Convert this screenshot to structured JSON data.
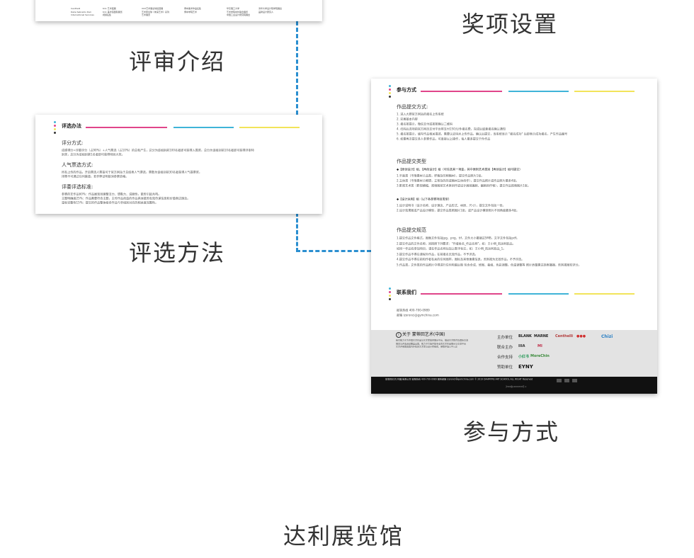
{
  "labels": {
    "review_intro": "评审介绍",
    "award_settings": "奖项设置",
    "selection_method": "评选方法",
    "participation": "参与方式",
    "gallery": "达利展览馆"
  },
  "colors": {
    "magenta": "#e0458a",
    "cyan": "#3fb4d8",
    "yellow": "#f2e45a",
    "dash_blue": "#2b8fd0",
    "footer_gray": "#e3e3e3",
    "footer_dark": "#111111"
  },
  "top_card": {
    "columns": [
      [
        "Centhelli",
        "Dalie Sabradio Dali",
        "International Services"
      ],
      [
        "K11 艺术夜展",
        "K11 美术馆国际展览",
        "视频征集"
      ],
      [
        "XXX艺术展全球巡回展",
        "艺术家全球《未来艺术》系列",
        "艺术展览"
      ],
      [
        "博中美术作品征集",
        "博中学院艺术"
      ],
      [
        "华东理工大学",
        "艺术学院中外联合展览",
        "中国工业设计研究院展出"
      ],
      [
        "清华大学设计院学院展出",
        "品牌设计研究人"
      ]
    ]
  },
  "selection_card": {
    "title": "评选办法",
    "scoring_heading": "评分方式:",
    "scoring_lines": [
      "成绩得分=评委评分（占90%）+人气票选（占10%）的总和产生，总分为该组别前100名者即可获得入围奖，总分为该组别前10名者即可获得评审特",
      "别奖，总分为该组别第1名者即可获得特别大奖。"
    ],
    "popular_heading": "人气票选方式:",
    "popular_lines": [
      "所有上传的作品，开启票选人票投可于官方网站于总结表人气票选，票数为该组别前30名者获得人气提票奖，",
      "排票不可通过任何渠道，若作弊证明取消参赛资格。"
    ],
    "criteria_heading": "评委评选标准:",
    "criteria_lines": [
      "参赛的艺作品60%：作品展现创意整洁力、想象力、说服性，能否引起共鸣。",
      "主题明确度25%：作品需要符合主题，主传作品创造的作品具体能否有效传递信息和价值表达理念。",
      "温标完整性15%：提交的作品整体组合作品与非组别对应的相关度完整性。"
    ]
  },
  "participation_card": {
    "title": "参与方式",
    "submit_heading": "作品提交方式:",
    "submit_lines": [
      "1. 进入大赛官方网站的报名上传系统",
      "2. 完善基本内容",
      "3. 报名按提示，微信支付或按按确认二维码",
      "4. 扫码后选项前官方网页支付平台将支付150元/件报名费，完成后留意报名确认通知",
      "5. 报名按提示，填写作品相关描述，需要认证码并上传作品，确认后提交，当系统显示 \"报名成功\" 后即表示成功报名，产生作品编号",
      "6. 如需再次提交多人参赛作品，可直接以上操作，每人最多提交于件作品"
    ],
    "type_heading": "作品提交类型",
    "type_a_title": "◆【原创设计】组、【再创设计】组（可任选其一项变，其中原则艺术类别【再创设计】组可提交）",
    "type_a_lines": [
      "1.平面类（不限素材兰品类，样稿及印刷稿材），提交作品照片1张。",
      "2.立体类（不限素材兰概想，立案及的的或稿材立体创作），提交作品照片或作品照片最多4张。",
      "3.影视艺术类（影视横幅、视频图前艺术原创作或设计展前编剧、编剧创作物），提交作品视频图片1张。"
    ],
    "type_b_title": "◆【设计运用】组（以下各参赛项目类型）",
    "type_b_lines": [
      "1.设计说明书（设计名称、设计理念、产品形式、材质、尺寸），提交文件包括一份。",
      "2.设计效果图或产品设计模型，提交作品类照图片1张，或产品设计模型照片不同角度最多4张。"
    ],
    "spec_heading": "作品提交规范",
    "spec_lines": [
      "1.提交作品文件格式，图像文件包括jpg、png、tif，文件大小最端达5MB，文字文件包括pdf。",
      "2.提交作品的文件名称，须按照下列要求：\"作者姓名_作品名称\"，如：王小明_凯运利取品。",
      "  如同一作品有参加项目，请在作品名称后加上数字标注，如：王小明_凯运利取品_1。",
      "3.提交作品不得在课程外作品，在前报名无效作品，不予评选。",
      "4.提交作品不得在前和作者有关的任何图样，图标及其他像素信息，否则视为无效作品，不予评选。",
      "5.作品类，文件类的作品照片中得进行任何电脑后制 包含合成、修图、裁组、色彩调整，色温调整等 照片质量需达到表播端，否则视图较评分。"
    ],
    "contact_title": "联系我们",
    "contact_phone": "报答热线 400-700-0989",
    "contact_email": "邮箱 izoronci@gymchina.com",
    "footer": {
      "about_title": "关于 蒙蒂回艺术(中国)",
      "about_lines": [
        "我们致力于为中国艺术作品与艺术家提供展示平台，推动艺术教育及国际交流",
        "展览与评选活动覆盖全国，致力于打造开放专业的艺术作品展示与交流平台",
        "艺术评审团由国内外知名艺术家与设计师组成，保障评选公平公正"
      ],
      "organizer_label": "主办单位",
      "co_organizer_label": "联合主办",
      "partner_label": "合作支持",
      "sponsor_label": "赞助单位",
      "organizer_logos": [
        "BLANK",
        "MARNE",
        "Centhelli",
        "●●●",
        "Chizi"
      ],
      "co_organizer_logos": [
        "IIIA",
        "MI"
      ],
      "partner_logos": [
        "小红书",
        "MoreChin"
      ],
      "sponsor_logos": [
        "EYNY"
      ]
    },
    "bottom_bar": "蒙蒂回艺术(中国)有限公司 客服热线 400-700-0989 服务邮箱 izoronci@gymchina.com © 2019 DAHMYRE ART SCHOOL ALL RIGHT Reserved",
    "bottom_bar_sub": "沪ICP备14000339号-1"
  }
}
